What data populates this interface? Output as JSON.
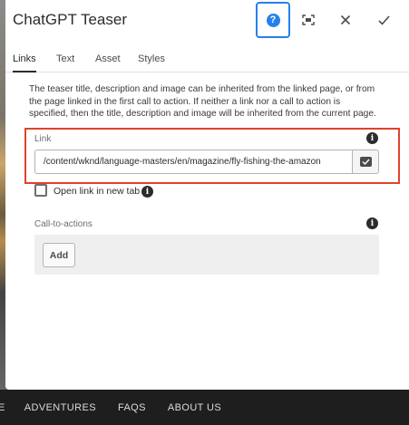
{
  "dialog": {
    "title": "ChatGPT Teaser",
    "help_icon_glyph": "?",
    "info_icon_glyph": "i"
  },
  "tabs": [
    {
      "label": "Links",
      "active": true
    },
    {
      "label": "Text",
      "active": false
    },
    {
      "label": "Asset",
      "active": false
    },
    {
      "label": "Styles",
      "active": false
    }
  ],
  "description": "The teaser title, description and image can be inherited from the linked page, or from the page linked in the first call to action. If neither a link nor a call to action is specified, then the title, description and image will be inherited from the current page.",
  "link_field": {
    "label": "Link",
    "value": "/content/wknd/language-masters/en/magazine/fly-fishing-the-amazon"
  },
  "open_new_tab": {
    "label": "Open link in new tab",
    "checked": false
  },
  "cta": {
    "label": "Call-to-actions",
    "add_label": "Add"
  },
  "bottom_nav": {
    "edge_glyph": "E",
    "items": [
      "ADVENTURES",
      "FAQS",
      "ABOUT US"
    ]
  },
  "colors": {
    "accent": "#2680eb",
    "highlight": "#e0422b",
    "nav_bg": "#1e1e1e"
  },
  "icons": [
    "help-icon",
    "fullscreen-icon",
    "close-icon",
    "checkmark-icon",
    "info-icon",
    "path-picker-icon"
  ]
}
